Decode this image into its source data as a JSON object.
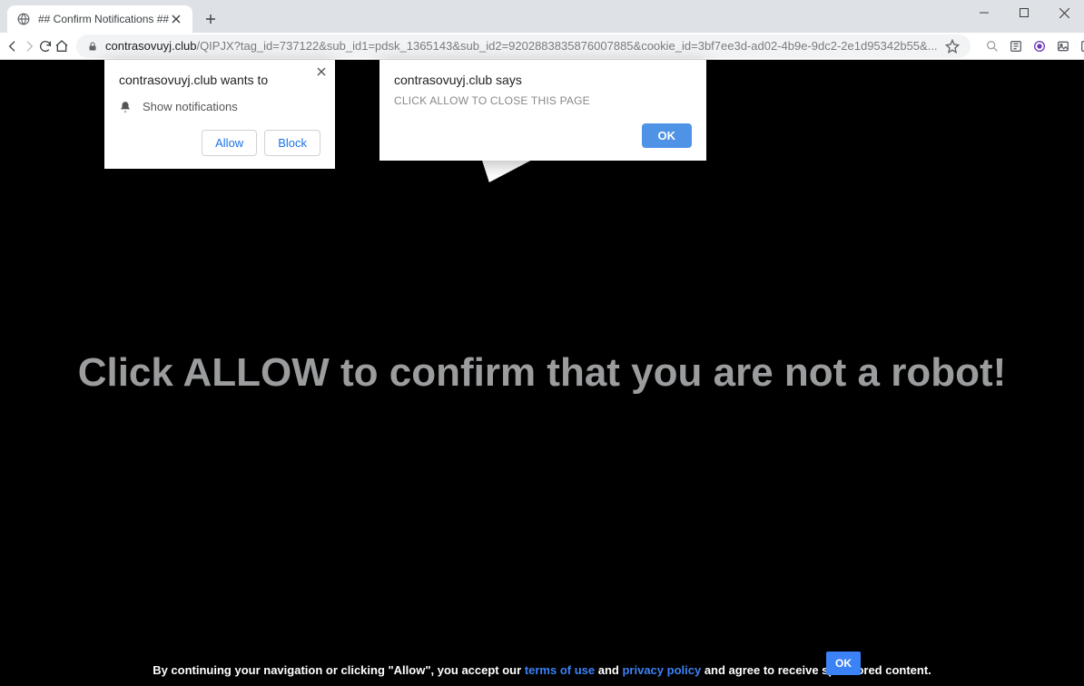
{
  "window": {
    "tab_title": "## Confirm Notifications ##"
  },
  "omnibox": {
    "host": "contrasovuyj.club",
    "path": "/QIPJX?tag_id=737122&sub_id1=pdsk_1365143&sub_id2=9202883835876007885&cookie_id=3bf7ee3d-ad02-4b9e-9dc2-2e1d95342b55&..."
  },
  "permission_prompt": {
    "title": "contrasovuyj.club wants to",
    "capability": "Show notifications",
    "allow": "Allow",
    "block": "Block"
  },
  "js_alert": {
    "title": "contrasovuyj.club says",
    "message": "CLICK ALLOW TO CLOSE THIS PAGE",
    "ok": "OK"
  },
  "page": {
    "hero": "Click ALLOW to confirm that you are not a robot!",
    "footer_pre": "By continuing your navigation or clicking \"Allow\", you accept our ",
    "terms": "terms of use",
    "and": " and ",
    "privacy": "privacy policy",
    "footer_post": " and agree to receive sponsored content.",
    "ok": "OK"
  }
}
